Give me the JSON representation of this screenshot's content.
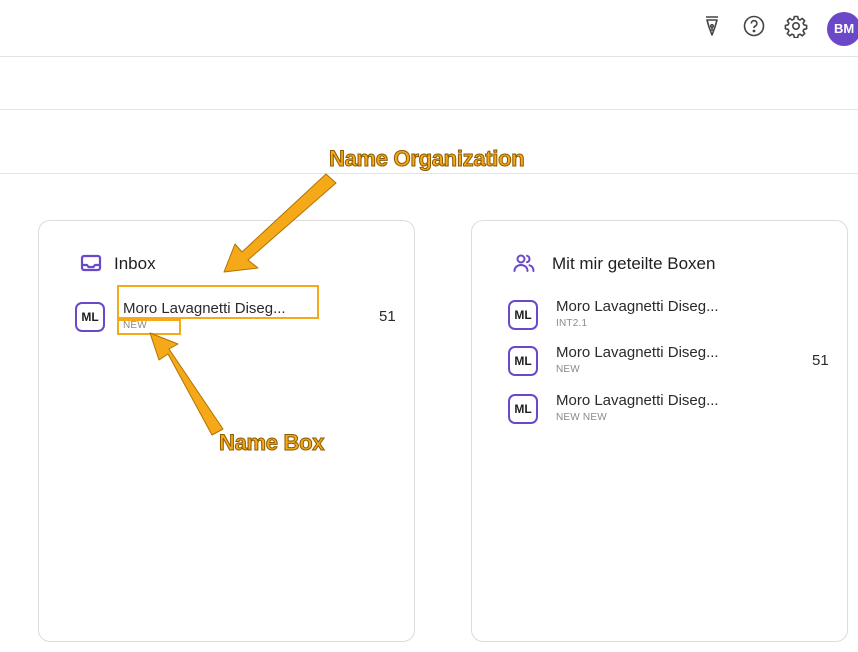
{
  "header": {
    "icons": [
      "pen-nib-icon",
      "help-icon",
      "gear-icon"
    ],
    "avatar_initials": "BM",
    "accent_color": "#6b48c8"
  },
  "inbox": {
    "title": "Inbox",
    "icon": "inbox-tray-icon",
    "items": [
      {
        "initials": "ML",
        "name": "Moro Lavagnetti Diseg...",
        "box": "NEW",
        "count": "51"
      }
    ]
  },
  "shared": {
    "title": "Mit mir geteilte Boxen",
    "icon": "users-icon",
    "items": [
      {
        "initials": "ML",
        "name": "Moro Lavagnetti Diseg...",
        "box": "INT2.1",
        "count": ""
      },
      {
        "initials": "ML",
        "name": "Moro Lavagnetti Diseg...",
        "box": "NEW",
        "count": "51"
      },
      {
        "initials": "ML",
        "name": "Moro Lavagnetti Diseg...",
        "box": "NEW NEW",
        "count": ""
      }
    ]
  },
  "annotations": {
    "organization_label": "Name Organization",
    "box_label": "Name Box",
    "color": "#f5a818"
  }
}
